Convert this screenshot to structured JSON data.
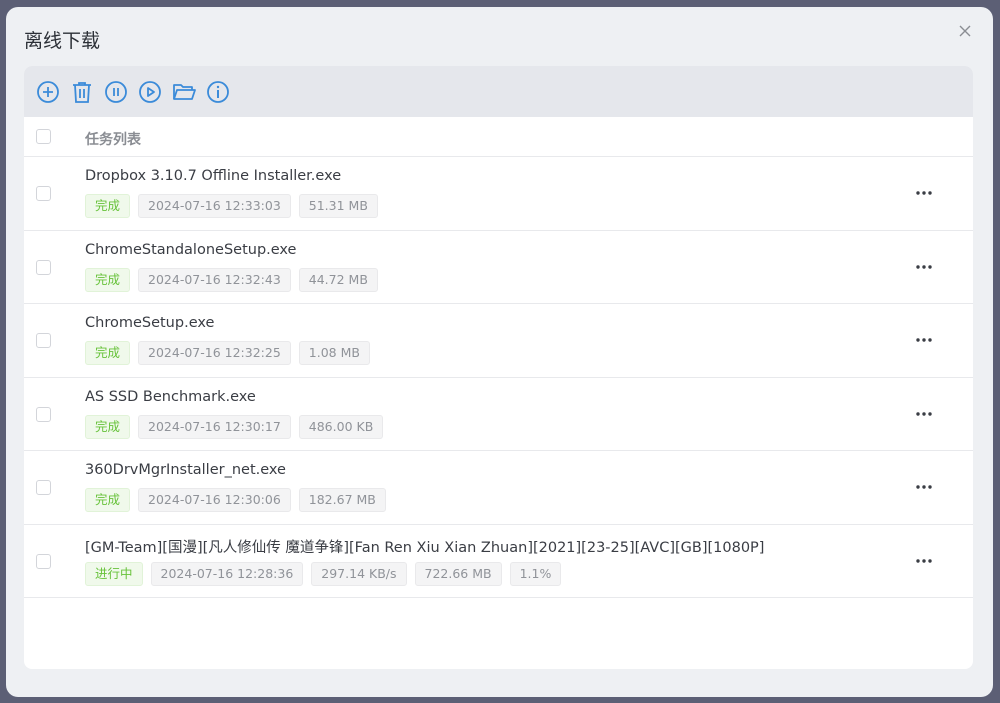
{
  "dialog": {
    "title": "离线下载"
  },
  "toolbar": {
    "icons": [
      "add-circle-icon",
      "trash-icon",
      "pause-icon",
      "play-icon",
      "folder-open-icon",
      "info-icon"
    ],
    "accent": "#3b8bd9"
  },
  "list": {
    "header": "任务列表",
    "tasks": [
      {
        "name": "Dropbox 3.10.7 Offline Installer.exe",
        "status": "完成",
        "time": "2024-07-16 12:33:03",
        "size": "51.31 MB"
      },
      {
        "name": "ChromeStandaloneSetup.exe",
        "status": "完成",
        "time": "2024-07-16 12:32:43",
        "size": "44.72 MB"
      },
      {
        "name": "ChromeSetup.exe",
        "status": "完成",
        "time": "2024-07-16 12:32:25",
        "size": "1.08 MB"
      },
      {
        "name": "AS SSD Benchmark.exe",
        "status": "完成",
        "time": "2024-07-16 12:30:17",
        "size": "486.00 KB"
      },
      {
        "name": "360DrvMgrInstaller_net.exe",
        "status": "完成",
        "time": "2024-07-16 12:30:06",
        "size": "182.67 MB"
      },
      {
        "name": "[GM-Team][国漫][凡人修仙传 魔道争锋][Fan Ren Xiu Xian Zhuan][2021][23-25][AVC][GB][1080P]",
        "status": "进行中",
        "time": "2024-07-16 12:28:36",
        "speed": "297.14 KB/s",
        "size": "722.66 MB",
        "progress": "1.1%"
      }
    ]
  }
}
